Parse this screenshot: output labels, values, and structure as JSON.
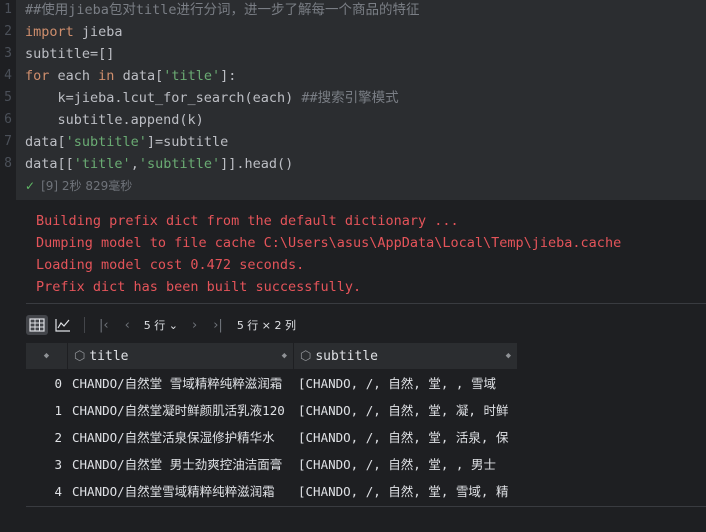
{
  "gutter": {
    "lines": [
      "1",
      "2",
      "3",
      "4",
      "5",
      "6",
      "7",
      "8"
    ]
  },
  "code": {
    "line1": "##使用jieba包对title进行分词，进一步了解每一个商品的特征",
    "line2_kw": "import",
    "line2_rest": " jieba",
    "line3": "subtitle=[]",
    "line4_for": "for",
    "line4_mid": " each ",
    "line4_in": "in",
    "line4_a": " data[",
    "line4_str": "'title'",
    "line4_b": "]:",
    "line5_code": "    k=jieba.lcut_for_search(each) ",
    "line5_comment": "##搜索引擎模式",
    "line6": "    subtitle.append(k)",
    "line7_a": "data[",
    "line7_str": "'subtitle'",
    "line7_b": "]=subtitle",
    "line8_a": "data[[",
    "line8_s1": "'title'",
    "line8_c": ",",
    "line8_s2": "'subtitle'",
    "line8_b": "]].head()"
  },
  "exec": {
    "check": "✓",
    "label": "[9] 2秒 829毫秒"
  },
  "stderr": [
    "Building prefix dict from the default dictionary ...",
    "Dumping model to file cache C:\\Users\\asus\\AppData\\Local\\Temp\\jieba.cache",
    "Loading model cost 0.472 seconds.",
    "Prefix dict has been built successfully."
  ],
  "toolbar": {
    "table_icon": "table-icon",
    "chart_icon": "chart-icon",
    "first": "|‹",
    "prev": "‹",
    "next": "›",
    "last": "›|",
    "page_size": "5 行 ⌄",
    "shape": "5 行 × 2 列"
  },
  "table": {
    "columns": [
      "title",
      "subtitle"
    ],
    "rows": [
      {
        "index": "0",
        "title": "CHANDO/自然堂 雪域精粹纯粹滋润霜",
        "subtitle": "[CHANDO, /, 自然, 堂,  , 雪域"
      },
      {
        "index": "1",
        "title": "CHANDO/自然堂凝时鲜颜肌活乳液120",
        "subtitle": "[CHANDO, /, 自然, 堂, 凝, 时鲜"
      },
      {
        "index": "2",
        "title": "CHANDO/自然堂活泉保湿修护精华水",
        "subtitle": "[CHANDO, /, 自然, 堂, 活泉, 保"
      },
      {
        "index": "3",
        "title": "CHANDO/自然堂 男士劲爽控油洁面膏",
        "subtitle": "[CHANDO, /, 自然, 堂,  , 男士"
      },
      {
        "index": "4",
        "title": "CHANDO/自然堂雪域精粹纯粹滋润霜",
        "subtitle": "[CHANDO, /, 自然, 堂, 雪域, 精"
      }
    ]
  }
}
